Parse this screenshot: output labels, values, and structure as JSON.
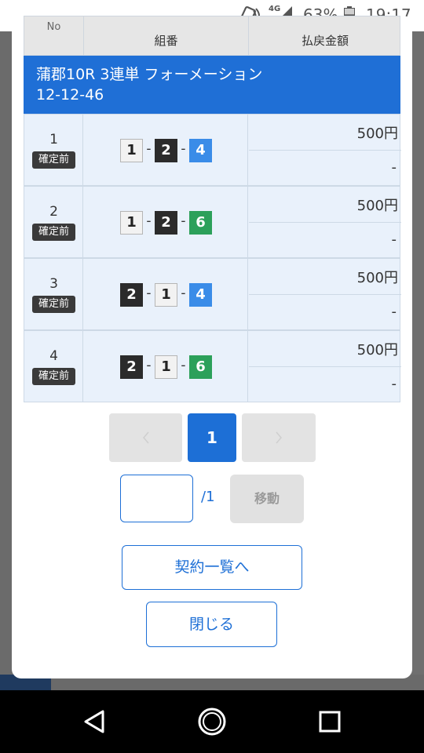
{
  "status_bar": {
    "network": "4G",
    "battery_percent": "63%",
    "battery_level": 0.63,
    "time": "19:17"
  },
  "table": {
    "headers": {
      "no": "No",
      "combination": "組番",
      "payout": "払戻金額"
    },
    "banner": {
      "line1": "蒲郡10R 3連単 フォーメーション",
      "line2": "12-12-46"
    },
    "rows": [
      {
        "no": "1",
        "status": "確定前",
        "boats": [
          {
            "num": "1",
            "style": "white"
          },
          {
            "num": "2",
            "style": "black"
          },
          {
            "num": "4",
            "style": "blue"
          }
        ],
        "amount": "500円",
        "payout": "-"
      },
      {
        "no": "2",
        "status": "確定前",
        "boats": [
          {
            "num": "1",
            "style": "white"
          },
          {
            "num": "2",
            "style": "black"
          },
          {
            "num": "6",
            "style": "green"
          }
        ],
        "amount": "500円",
        "payout": "-"
      },
      {
        "no": "3",
        "status": "確定前",
        "boats": [
          {
            "num": "2",
            "style": "black"
          },
          {
            "num": "1",
            "style": "white"
          },
          {
            "num": "4",
            "style": "blue"
          }
        ],
        "amount": "500円",
        "payout": "-"
      },
      {
        "no": "4",
        "status": "確定前",
        "boats": [
          {
            "num": "2",
            "style": "black"
          },
          {
            "num": "1",
            "style": "white"
          },
          {
            "num": "6",
            "style": "green"
          }
        ],
        "amount": "500円",
        "payout": "-"
      }
    ],
    "separator": "-"
  },
  "pagination": {
    "current_page": "1",
    "total": "/1",
    "jump_value": "",
    "jump_button": "移動"
  },
  "buttons": {
    "contract_list": "契約一覧へ",
    "close": "閉じる"
  },
  "colors": {
    "accent": "#1d6fd6",
    "boat_white": "#f2f2f2",
    "boat_black": "#2b2b2b",
    "boat_blue": "#3a8ce8",
    "boat_green": "#2ca05a"
  }
}
